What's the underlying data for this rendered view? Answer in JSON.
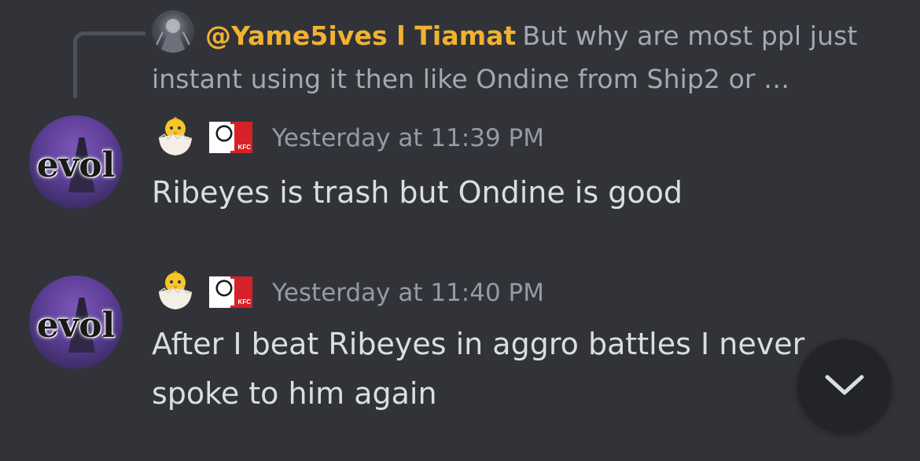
{
  "reply": {
    "author": "@Yame5ives l Tiamat",
    "text": "But why are most ppl just instant using it then like Ondine from Ship2 or …"
  },
  "messages": [
    {
      "timestamp": "Yesterday at 11:39 PM",
      "text": "Ribeyes is trash but Ondine is good"
    },
    {
      "timestamp": "Yesterday at 11:40 PM",
      "text": "After I beat Ribeyes in aggro battles I never spoke to him again"
    }
  ],
  "avatar": {
    "text": "evol"
  },
  "badges": {
    "role_icon": "hatching-chick-emoji",
    "server_icon": "kfc-logo-icon"
  },
  "scroll_button": {
    "icon": "chevron-down-icon"
  },
  "colors": {
    "background": "#313338",
    "reply_author": "#f0b232",
    "message_text": "#dbdee1",
    "timestamp": "#949ba4",
    "reply_text": "#a4a8b1"
  }
}
